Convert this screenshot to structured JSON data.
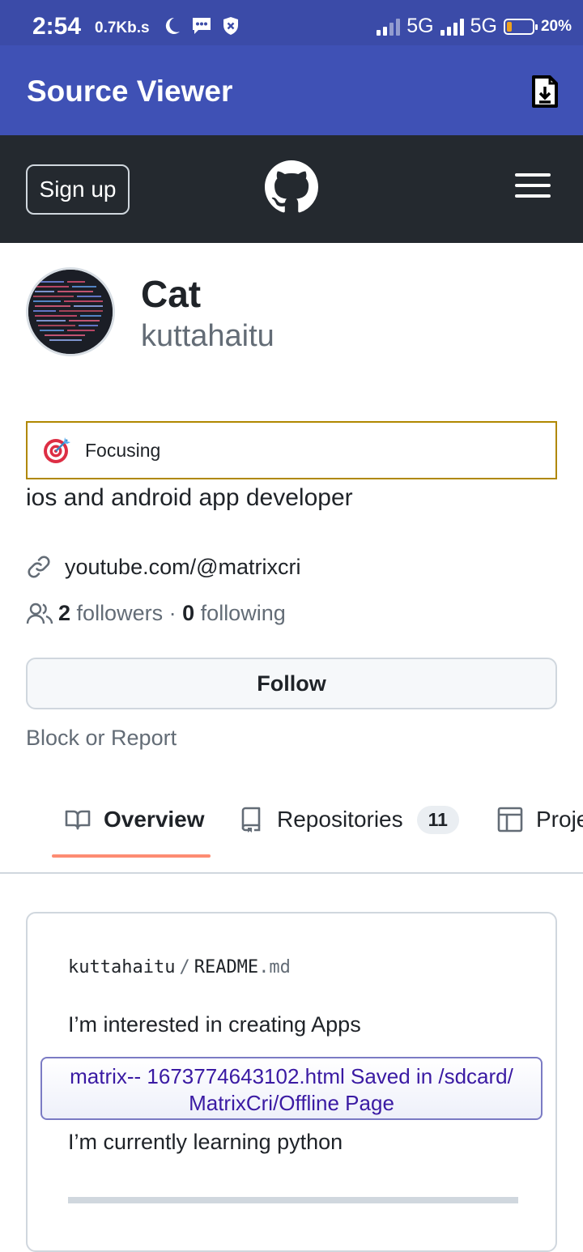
{
  "status_bar": {
    "time": "2:54",
    "net_speed": "0.7Kb.s",
    "network_1": "5G",
    "network_2": "5G",
    "battery_percent": "20%",
    "battery_level": 0.2,
    "battery_color": "#f0a21c"
  },
  "app_bar": {
    "title": "Source Viewer",
    "action_icon": "download-file-icon"
  },
  "github_header": {
    "signup_label": "Sign up",
    "logo_icon": "github-logo-icon",
    "menu_icon": "hamburger-menu-icon"
  },
  "profile": {
    "name": "Cat",
    "login": "kuttahaitu",
    "status_emoji": "direct-hit-target-icon",
    "status_text": "Focusing",
    "bio": "ios and android app developer",
    "website": "youtube.com/@matrixcri",
    "followers_count": "2",
    "followers_label": "followers",
    "separator": "·",
    "following_count": "0",
    "following_label": "following",
    "follow_button": "Follow",
    "block_report": "Block or Report"
  },
  "tabs": [
    {
      "label": "Overview",
      "icon": "book-icon",
      "selected": true
    },
    {
      "label": "Repositories",
      "icon": "repo-icon",
      "counter": "11"
    },
    {
      "label": "Proje",
      "icon": "table-icon"
    }
  ],
  "readme": {
    "owner": "kuttahaitu",
    "slash": "/",
    "file_base": "README",
    "file_ext": ".md",
    "line_1": "I’m interested in creating Apps",
    "line_2": "I’m currently learning python"
  },
  "toast": {
    "line_1": "matrix-- 1673774643102.html Saved in /sdcard/",
    "line_2": "MatrixCri/Offline Page"
  },
  "colors": {
    "status_bar_bg": "#3b4ba8",
    "app_bar_bg": "#3f51b5",
    "github_header_bg": "#24292f",
    "status_border": "#b08800",
    "tab_underline": "#fd8c73",
    "toast_text": "#3a1aa3"
  }
}
